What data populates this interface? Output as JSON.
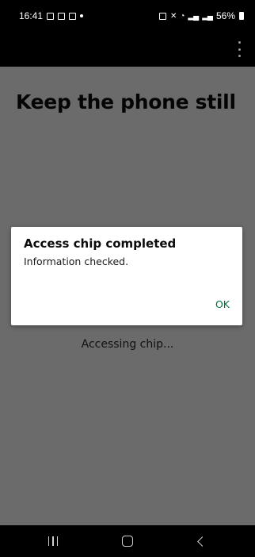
{
  "status_bar": {
    "time": "16:41",
    "battery_percent": "56%",
    "icons": [
      "gallery-icon",
      "message-icon",
      "mail-icon",
      "dot-icon",
      "alarm-icon",
      "mute-icon",
      "wifi-icon",
      "signal-icon",
      "signal-icon",
      "battery-icon"
    ]
  },
  "app_bar": {
    "menu_icon": "more-vertical-icon"
  },
  "page": {
    "title": "Keep the phone still",
    "status_text": "Accessing chip..."
  },
  "dialog": {
    "title": "Access chip completed",
    "message": "Information checked.",
    "ok_label": "OK"
  },
  "nav_bar": {
    "buttons": [
      "recents-icon",
      "home-icon",
      "back-icon"
    ]
  },
  "colors": {
    "scrim": "#6b6b6b",
    "accent": "#00703c",
    "bar_background": "#000000"
  }
}
